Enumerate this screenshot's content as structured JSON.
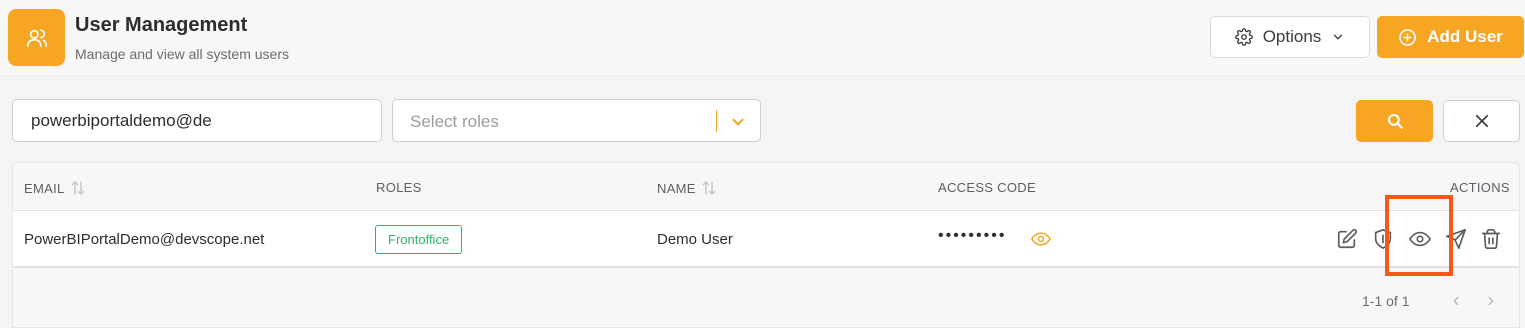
{
  "header": {
    "icon": "users-icon",
    "title": "User Management",
    "subtitle": "Manage and view all system users",
    "options_label": "Options",
    "add_label": "Add User"
  },
  "filters": {
    "email_value": "powerbiportaldemo@de",
    "roles_placeholder": "Select roles"
  },
  "table": {
    "columns": [
      "EMAIL",
      "ROLES",
      "NAME",
      "ACCESS CODE",
      "ACTIONS"
    ],
    "rows": [
      {
        "email": "PowerBIPortalDemo@devscope.net",
        "role": "Frontoffice",
        "name": "Demo User",
        "access_code": "•••••••••"
      }
    ],
    "row_actions": [
      "edit-icon",
      "shield-icon",
      "eye-icon",
      "send-icon",
      "trash-icon"
    ]
  },
  "pagination": {
    "range": "1-1 of 1"
  },
  "colors": {
    "accent": "#f6a623",
    "role_badge": "#2fb36b",
    "highlight": "#f35a1a"
  }
}
